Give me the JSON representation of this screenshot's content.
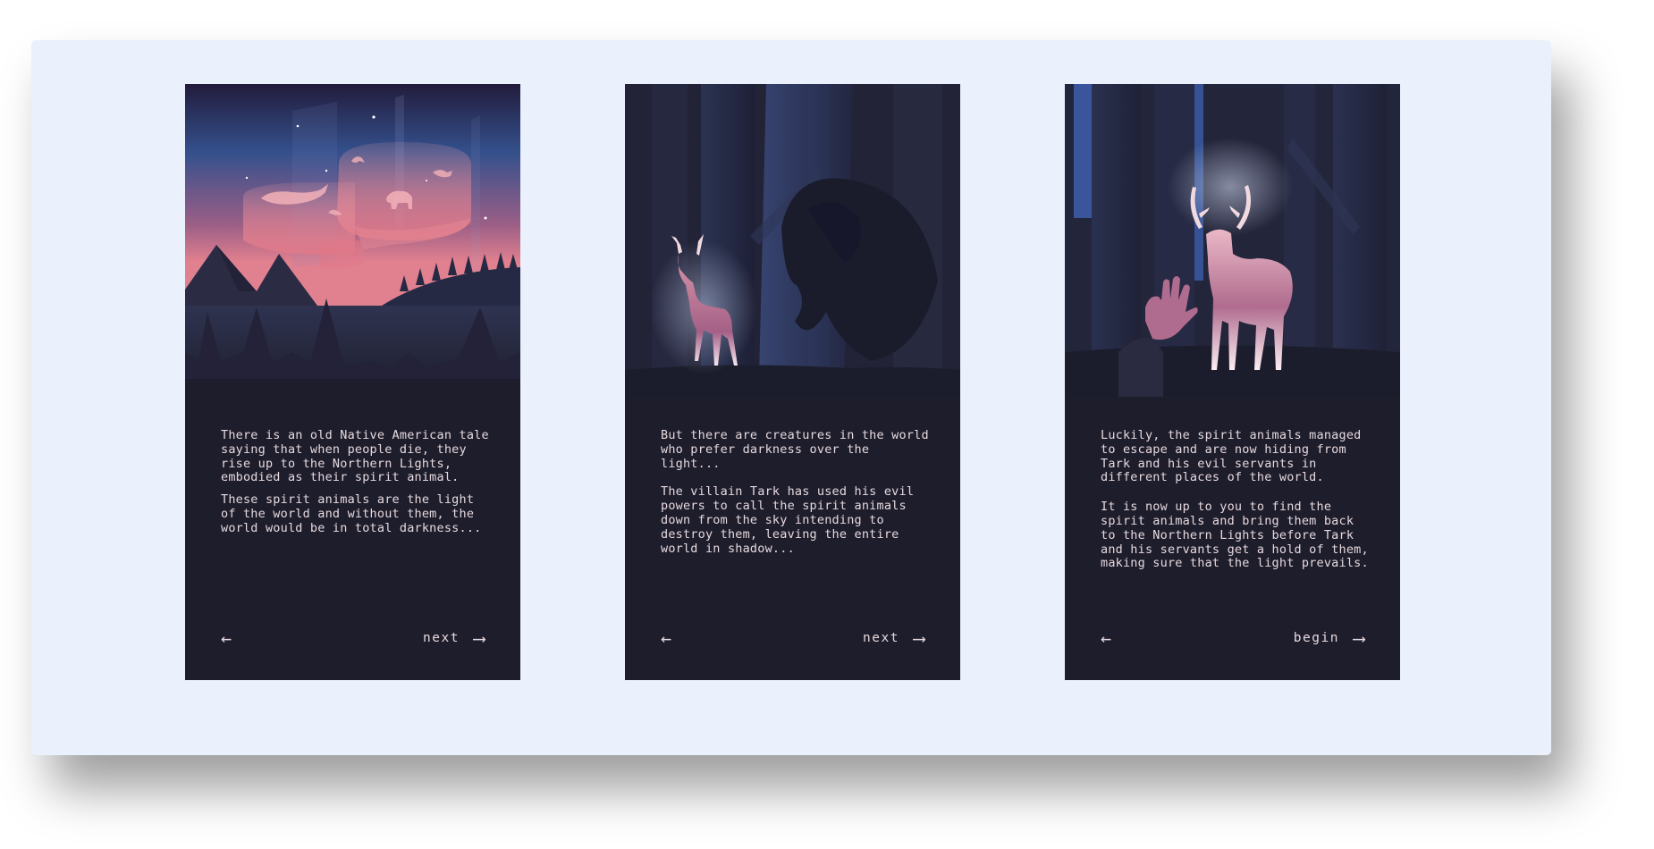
{
  "cards": [
    {
      "illustration": "aurora-spirit-animals-over-mountains",
      "paragraphs": [
        "There is an old Native American tale  saying that when people die, they rise up to the Northern Lights, embodied as their spirit animal.",
        "These spirit animals are the light of the world and without them, the world would be in total darkness..."
      ],
      "back_icon": "←",
      "next_label": "next",
      "next_icon": "⟶"
    },
    {
      "illustration": "glowing-deer-in-dark-forest",
      "paragraphs": [
        "But there are creatures in the world who prefer darkness over the light...",
        "The villain Tark has used his evil powers to call the spirit animals down from the sky intending to destroy them, leaving the entire world in shadow..."
      ],
      "back_icon": "←",
      "next_label": "next",
      "next_icon": "⟶"
    },
    {
      "illustration": "hand-reaching-toward-glowing-deer",
      "paragraphs": [
        "Luckily, the spirit animals managed to escape and are now hiding from Tark and his evil servants in different places of the world.",
        "It is now up to you to find the spirit animals and bring them back to the Northern Lights before Tark and his servants get a hold of them, making sure that the light prevails."
      ],
      "back_icon": "←",
      "next_label": "begin",
      "next_icon": "⟶"
    }
  ],
  "colors": {
    "board": "#eaf1fc",
    "card": "#1e1d2b",
    "text": "#e6d9df",
    "aurora_pink": "#e0808f",
    "sky_blue": "#3c5a9c"
  }
}
